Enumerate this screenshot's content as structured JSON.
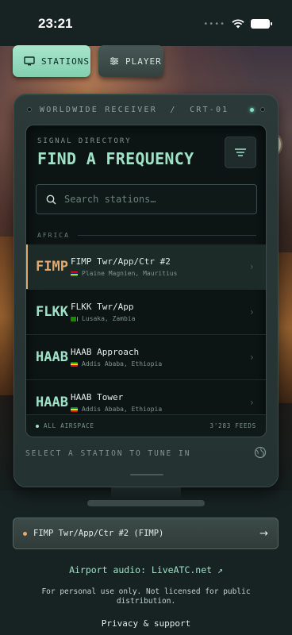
{
  "status": {
    "time": "23:21",
    "dots": "••••"
  },
  "tabs": [
    {
      "label": "STATIONS",
      "icon": "monitor-icon",
      "active": true
    },
    {
      "label": "PLAYER",
      "icon": "sliders-icon",
      "active": false
    }
  ],
  "receiver": {
    "title": "WORLDWIDE RECEIVER  /  CRT-01",
    "directory_label": "SIGNAL DIRECTORY",
    "directory_title": "FIND A FREQUENCY",
    "search_placeholder": "Search stations…",
    "region": "AFRICA",
    "stations": [
      {
        "icao": "FIMP",
        "name": "FIMP Twr/App/Ctr #2",
        "location": "Plaine Magnien, Mauritius",
        "active": true
      },
      {
        "icao": "FLKK",
        "name": "FLKK Twr/App",
        "location": "Lusaka, Zambia",
        "active": false
      },
      {
        "icao": "HAAB",
        "name": "HAAB Approach",
        "location": "Addis Ababa, Ethiopia",
        "active": false
      },
      {
        "icao": "HAAB",
        "name": "HAAB Tower",
        "location": "Addis Ababa, Ethiopia",
        "active": false
      }
    ],
    "footer_left": "ALL AIRSPACE",
    "footer_right": "3'283 FEEDS",
    "hint": "SELECT A STATION TO TUNE IN"
  },
  "now_playing": "FIMP Twr/App/Ctr #2 (FIMP)",
  "links": {
    "airport_audio": "Airport audio: LiveATC.net ↗",
    "disclaimer": "For personal use only. Not licensed for public distribution.",
    "privacy": "Privacy & support"
  },
  "colors": {
    "accent": "#9fe2c8",
    "active": "#e6a96a",
    "background": "#172322"
  }
}
